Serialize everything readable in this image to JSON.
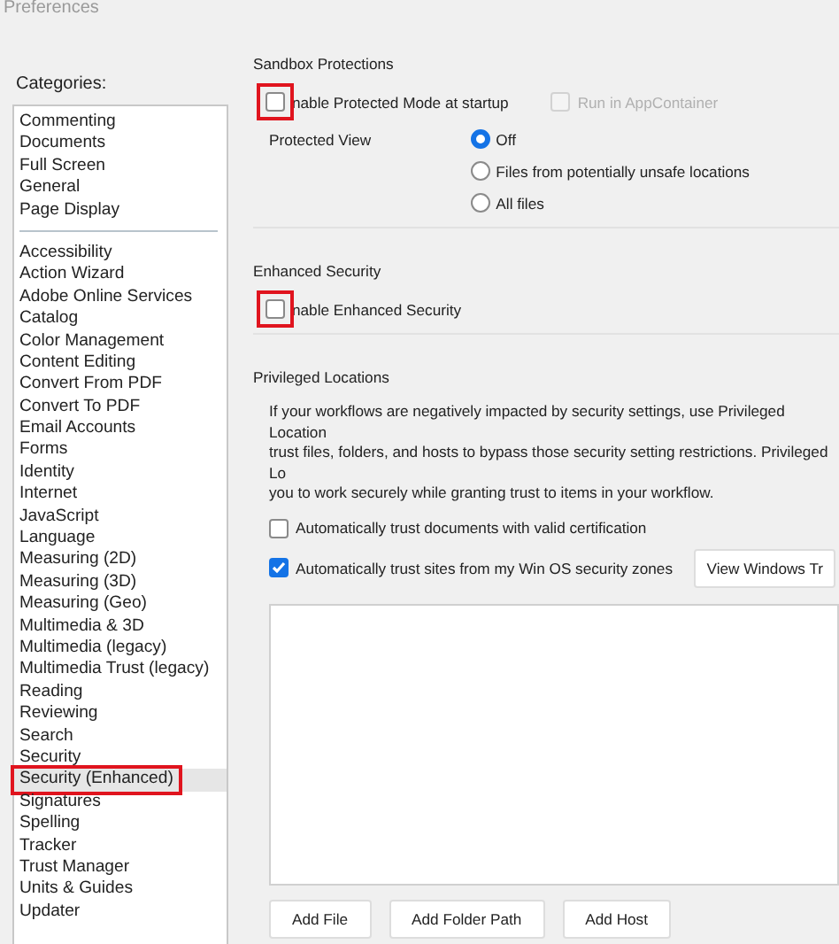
{
  "window": {
    "title": "Preferences"
  },
  "categories": {
    "label": "Categories:",
    "groups": [
      {
        "items": [
          {
            "label": "Commenting",
            "selected": false,
            "highlighted": false
          },
          {
            "label": "Documents",
            "selected": false,
            "highlighted": false
          },
          {
            "label": "Full Screen",
            "selected": false,
            "highlighted": false
          },
          {
            "label": "General",
            "selected": false,
            "highlighted": false
          },
          {
            "label": "Page Display",
            "selected": false,
            "highlighted": false
          }
        ]
      },
      {
        "items": [
          {
            "label": "Accessibility",
            "selected": false,
            "highlighted": false
          },
          {
            "label": "Action Wizard",
            "selected": false,
            "highlighted": false
          },
          {
            "label": "Adobe Online Services",
            "selected": false,
            "highlighted": false
          },
          {
            "label": "Catalog",
            "selected": false,
            "highlighted": false
          },
          {
            "label": "Color Management",
            "selected": false,
            "highlighted": false
          },
          {
            "label": "Content Editing",
            "selected": false,
            "highlighted": false
          },
          {
            "label": "Convert From PDF",
            "selected": false,
            "highlighted": false
          },
          {
            "label": "Convert To PDF",
            "selected": false,
            "highlighted": false
          },
          {
            "label": "Email Accounts",
            "selected": false,
            "highlighted": false
          },
          {
            "label": "Forms",
            "selected": false,
            "highlighted": false
          },
          {
            "label": "Identity",
            "selected": false,
            "highlighted": false
          },
          {
            "label": "Internet",
            "selected": false,
            "highlighted": false
          },
          {
            "label": "JavaScript",
            "selected": false,
            "highlighted": false
          },
          {
            "label": "Language",
            "selected": false,
            "highlighted": false
          },
          {
            "label": "Measuring (2D)",
            "selected": false,
            "highlighted": false
          },
          {
            "label": "Measuring (3D)",
            "selected": false,
            "highlighted": false
          },
          {
            "label": "Measuring (Geo)",
            "selected": false,
            "highlighted": false
          },
          {
            "label": "Multimedia & 3D",
            "selected": false,
            "highlighted": false
          },
          {
            "label": "Multimedia (legacy)",
            "selected": false,
            "highlighted": false
          },
          {
            "label": "Multimedia Trust (legacy)",
            "selected": false,
            "highlighted": false
          },
          {
            "label": "Reading",
            "selected": false,
            "highlighted": false
          },
          {
            "label": "Reviewing",
            "selected": false,
            "highlighted": false
          },
          {
            "label": "Search",
            "selected": false,
            "highlighted": false
          },
          {
            "label": "Security",
            "selected": false,
            "highlighted": false
          },
          {
            "label": "Security (Enhanced)",
            "selected": true,
            "highlighted": true
          },
          {
            "label": "Signatures",
            "selected": false,
            "highlighted": false
          },
          {
            "label": "Spelling",
            "selected": false,
            "highlighted": false
          },
          {
            "label": "Tracker",
            "selected": false,
            "highlighted": false
          },
          {
            "label": "Trust Manager",
            "selected": false,
            "highlighted": false
          },
          {
            "label": "Units & Guides",
            "selected": false,
            "highlighted": false
          },
          {
            "label": "Updater",
            "selected": false,
            "highlighted": false
          }
        ]
      }
    ]
  },
  "sandbox": {
    "heading": "Sandbox Protections",
    "protected_mode": {
      "label": "nable Protected Mode at startup",
      "checked": false,
      "disabled": false,
      "highlighted": true
    },
    "app_container": {
      "label": "Run in AppContainer",
      "checked": false,
      "disabled": true,
      "highlighted": false
    },
    "protected_view": {
      "label": "Protected View",
      "options": [
        {
          "label": "Off",
          "selected": true
        },
        {
          "label": "Files from potentially unsafe locations",
          "selected": false
        },
        {
          "label": "All files",
          "selected": false
        }
      ]
    }
  },
  "enhanced_security": {
    "heading": "Enhanced Security",
    "enable": {
      "label": "nable Enhanced Security",
      "checked": false,
      "disabled": false,
      "highlighted": true
    }
  },
  "privileged_locations": {
    "heading": "Privileged Locations",
    "description_lines": [
      "If your workflows are negatively impacted by security settings, use Privileged Location",
      "trust files, folders, and hosts to bypass those security setting restrictions. Privileged Lo",
      "you to work securely while granting trust to items in your workflow."
    ],
    "options": [
      {
        "label": "Automatically trust documents with valid certification",
        "checked": false,
        "disabled": false,
        "highlighted": false
      },
      {
        "label": "Automatically trust sites from my Win OS security zones",
        "checked": true,
        "disabled": false,
        "highlighted": false
      }
    ],
    "view_button": "View Windows Tr",
    "buttons": [
      "Add File",
      "Add Folder Path",
      "Add Host"
    ]
  }
}
